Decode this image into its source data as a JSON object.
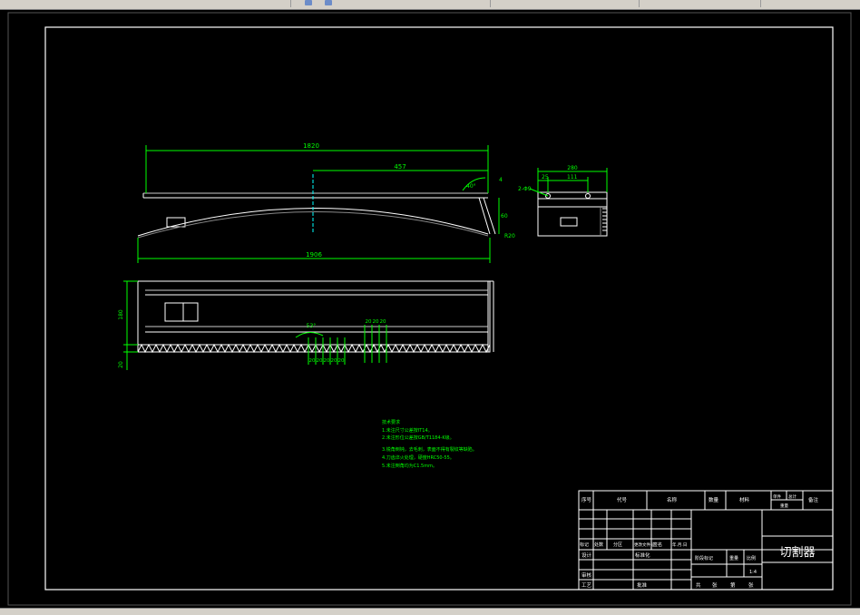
{
  "app": {
    "toolbar_icons": [
      "search-icon",
      "settings-icon"
    ]
  },
  "drawing": {
    "title": "切割器",
    "dimensions": {
      "overall_top": "1820",
      "half_length": "457",
      "angle_top": "40°",
      "small_4": "4",
      "vertical_60": "60",
      "radius_r20": "R20",
      "bottom_length": "1906",
      "end_width": "280",
      "end_25": "25",
      "end_111": "111",
      "end_hole": "2-Φ9",
      "front_height": "180",
      "front_20": "20",
      "teeth_angle": "53°",
      "tooth_pitch_top": [
        "20",
        "20",
        "20"
      ],
      "tooth_pitch_bottom": [
        "20",
        "20",
        "20",
        "20",
        "20"
      ]
    },
    "notes": [
      "技术要求",
      "1.未注尺寸公差按IT14。",
      "2.未注形位公差按GB/T1184-K级。",
      "3.锐角倒钝，去毛刺，表面不得有裂纹等缺陷。",
      "4.刀齿淬火处理，硬度HRC50-55。",
      "5.未注倒角均为C1.5mm。"
    ],
    "title_block": {
      "header": [
        "序号",
        "代号",
        "名称",
        "数量",
        "材料",
        "单件",
        "总计",
        "重量",
        "备注"
      ],
      "rev_labels": [
        "标记",
        "处数",
        "分区",
        "更改文件号",
        "签名",
        "年.月.日"
      ],
      "row_labels": [
        "设计",
        "标准化",
        "审核",
        "工艺",
        "批准"
      ],
      "stage_labels": [
        "阶段标记",
        "重量",
        "比例"
      ],
      "scale": "1:4",
      "sheets": [
        "共",
        "张",
        "第",
        "张"
      ]
    },
    "colors": {
      "background": "#000000",
      "line": "#ffffff",
      "dimension": "#00ff00",
      "accent": "#00ffff",
      "notes": "#00ff00"
    }
  }
}
